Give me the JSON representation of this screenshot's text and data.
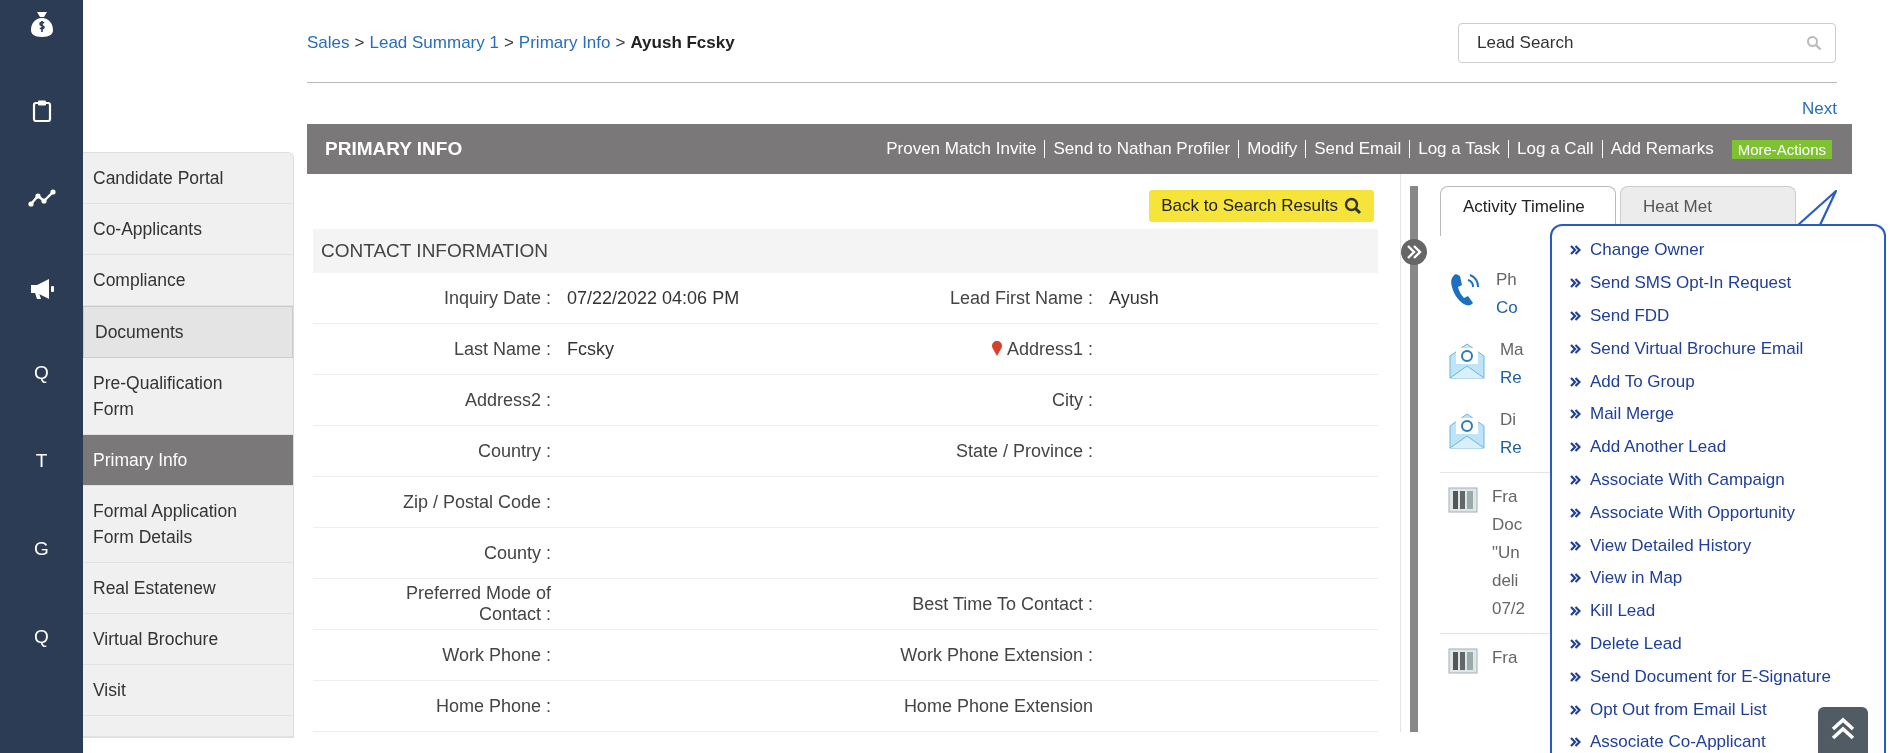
{
  "nav_rail": {
    "items": [
      {
        "kind": "money-bag"
      },
      {
        "kind": "clipboard"
      },
      {
        "kind": "chart"
      },
      {
        "kind": "megaphone"
      },
      {
        "kind": "letter",
        "label": "Q"
      },
      {
        "kind": "letter",
        "label": "T"
      },
      {
        "kind": "letter",
        "label": "G"
      },
      {
        "kind": "letter",
        "label": "Q"
      }
    ]
  },
  "sidebar": {
    "items": [
      {
        "label": "Candidate Portal",
        "selected": false,
        "hovered": false
      },
      {
        "label": "Co-Applicants",
        "selected": false,
        "hovered": false
      },
      {
        "label": "Compliance",
        "selected": false,
        "hovered": false
      },
      {
        "label": "Documents",
        "selected": false,
        "hovered": true
      },
      {
        "label": "Pre-Qualification Form",
        "selected": false,
        "hovered": false
      },
      {
        "label": "Primary Info",
        "selected": true,
        "hovered": false
      },
      {
        "label": "Formal Application Form Details",
        "selected": false,
        "hovered": false
      },
      {
        "label": "Real Estatenew",
        "selected": false,
        "hovered": false
      },
      {
        "label": "Virtual Brochure",
        "selected": false,
        "hovered": false
      },
      {
        "label": "Visit",
        "selected": false,
        "hovered": false
      }
    ]
  },
  "breadcrumb": {
    "links": [
      "Sales",
      "Lead Summary 1",
      "Primary Info"
    ],
    "separator": ">",
    "current": "Ayush Fcsky"
  },
  "search": {
    "placeholder": "Lead Search"
  },
  "next_link": "Next",
  "header": {
    "title": "PRIMARY INFO",
    "actions": [
      "Proven Match Invite",
      "Send to Nathan Profiler",
      "Modify",
      "Send Email",
      "Log a Task",
      "Log a Call",
      "Add Remarks"
    ],
    "more_actions": "More-Actions"
  },
  "back_button": "Back to Search Results",
  "section_title": "CONTACT INFORMATION",
  "fields": [
    {
      "left": {
        "label": "Inquiry Date :",
        "value": "07/22/2022 04:06 PM"
      },
      "right": {
        "label": "Lead First Name :",
        "value": "Ayush"
      }
    },
    {
      "left": {
        "label": "Last Name :",
        "value": "Fcsky"
      },
      "right": {
        "label": "Address1 :",
        "pin": true
      }
    },
    {
      "left": {
        "label": "Address2 :"
      },
      "right": {
        "label": "City :"
      }
    },
    {
      "left": {
        "label": "Country :"
      },
      "right": {
        "label": "State / Province :"
      }
    },
    {
      "left": {
        "label": "Zip / Postal Code :"
      }
    },
    {
      "left": {
        "label": "County :"
      }
    },
    {
      "left": {
        "label": "Preferred Mode of Contact :"
      },
      "right": {
        "label": "Best Time To Contact :"
      }
    },
    {
      "left": {
        "label": "Work Phone :"
      },
      "right": {
        "label": "Work Phone Extension :"
      }
    },
    {
      "left": {
        "label": "Home Phone :"
      },
      "right": {
        "label": "Home Phone Extension"
      }
    }
  ],
  "timeline": {
    "tabs": [
      {
        "label": "Activity Timeline",
        "selected": true
      },
      {
        "label": "Heat Met",
        "selected": false
      }
    ],
    "items": [
      {
        "kind": "call",
        "lines": [
          "Ph",
          "Co"
        ]
      },
      {
        "kind": "mail",
        "lines": [
          "Ma",
          "Re"
        ]
      },
      {
        "kind": "mail",
        "lines": [
          "Di",
          "Re"
        ]
      },
      {
        "kind": "document",
        "lines": [
          "Fra",
          "Doc",
          "\"Un",
          "deli",
          "07/2"
        ]
      },
      {
        "kind": "document",
        "lines": [
          "Fra"
        ]
      }
    ]
  },
  "more_actions_menu": {
    "items": [
      "Change Owner",
      "Send SMS Opt-In Request",
      "Send FDD",
      "Send Virtual Brochure Email",
      "Add To Group",
      "Mail Merge",
      "Add Another Lead",
      "Associate With Campaign",
      "Associate With Opportunity",
      "View Detailed History",
      "View in Map",
      "Kill Lead",
      "Delete Lead",
      "Send Document for E-Signature",
      "Opt Out from Email List",
      "Associate Co-Applicant"
    ]
  }
}
